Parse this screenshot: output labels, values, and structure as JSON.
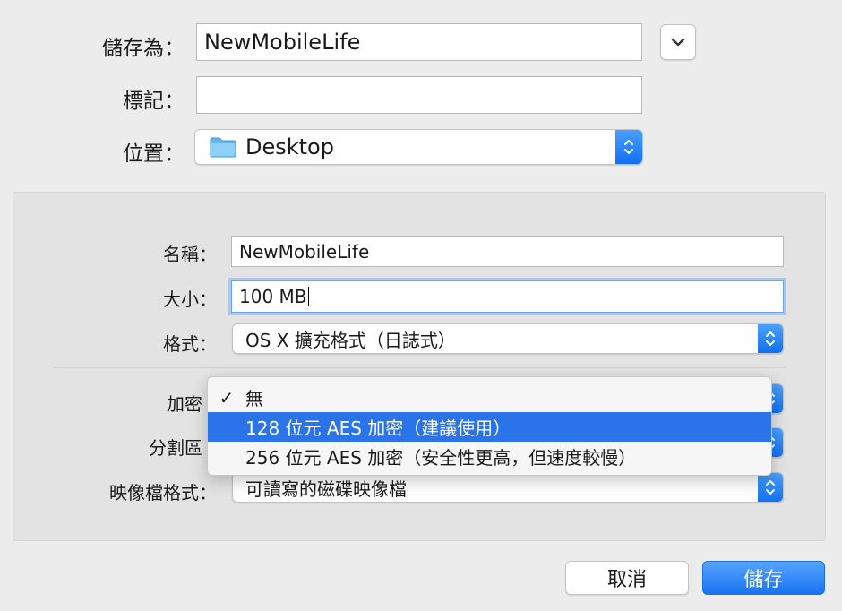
{
  "top": {
    "save_as_label": "儲存為：",
    "save_as_value": "NewMobileLife",
    "tags_label": "標記：",
    "tags_value": "",
    "where_label": "位置：",
    "where_value": "Desktop"
  },
  "image": {
    "name_label": "名稱：",
    "name_value": "NewMobileLife",
    "size_label": "大小：",
    "size_value": "100 MB",
    "format_label": "格式：",
    "format_value": "OS X 擴充格式（日誌式）",
    "encryption_label": "加密",
    "partitions_label": "分割區",
    "image_format_label": "映像檔格式：",
    "image_format_value": "可讀寫的磁碟映像檔"
  },
  "encryption_menu": {
    "items": [
      {
        "label": "無",
        "checked": true
      },
      {
        "label": "128 位元 AES 加密（建議使用）",
        "selected": true
      },
      {
        "label": "256 位元 AES 加密（安全性更高，但速度較慢）"
      }
    ],
    "check_glyph": "✓"
  },
  "buttons": {
    "cancel": "取消",
    "save": "儲存"
  },
  "colors": {
    "accent": "#2a73e8",
    "focus_ring": "#7fb0ef",
    "folder": "#5fb6f0"
  }
}
